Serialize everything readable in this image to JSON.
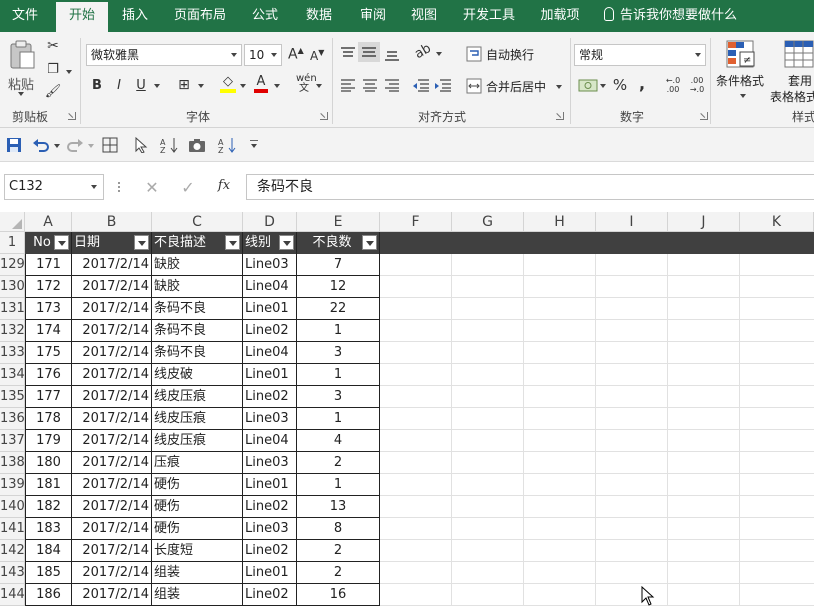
{
  "ribbon_tabs": [
    "文件",
    "开始",
    "插入",
    "页面布局",
    "公式",
    "数据",
    "审阅",
    "视图",
    "开发工具",
    "加载项"
  ],
  "tell_me": "告诉我你想要做什么",
  "clipboard": {
    "paste_label": "粘贴",
    "group_label": "剪贴板"
  },
  "font": {
    "name": "微软雅黑",
    "size": "10",
    "group_label": "字体",
    "bold": "B",
    "italic": "I",
    "underline": "U"
  },
  "alignment": {
    "wrap_text": "自动换行",
    "merge_center": "合并后居中",
    "group_label": "对齐方式"
  },
  "number": {
    "format": "常规",
    "percent": "%",
    "comma": ",",
    "group_label": "数字"
  },
  "styles": {
    "conditional_format": "条件格式",
    "table_format_1": "套用",
    "table_format_2": "表格格式",
    "group_label_partial": "样式"
  },
  "name_box": "C132",
  "formula_value": "条码不良",
  "fx_label": "fx",
  "columns": [
    "A",
    "B",
    "C",
    "D",
    "E",
    "F",
    "G",
    "H",
    "I",
    "J",
    "K"
  ],
  "table_headers": [
    "No",
    "日期",
    "不良描述",
    "线别",
    "不良数"
  ],
  "header_row_number": "1",
  "rows": [
    {
      "row": "129",
      "no": "171",
      "date": "2017/2/14",
      "desc": "缺胶",
      "line": "Line03",
      "qty": "7"
    },
    {
      "row": "130",
      "no": "172",
      "date": "2017/2/14",
      "desc": "缺胶",
      "line": "Line04",
      "qty": "12"
    },
    {
      "row": "131",
      "no": "173",
      "date": "2017/2/14",
      "desc": "条码不良",
      "line": "Line01",
      "qty": "22"
    },
    {
      "row": "132",
      "no": "174",
      "date": "2017/2/14",
      "desc": "条码不良",
      "line": "Line02",
      "qty": "1"
    },
    {
      "row": "133",
      "no": "175",
      "date": "2017/2/14",
      "desc": "条码不良",
      "line": "Line04",
      "qty": "3"
    },
    {
      "row": "134",
      "no": "176",
      "date": "2017/2/14",
      "desc": "线皮破",
      "line": "Line01",
      "qty": "1"
    },
    {
      "row": "135",
      "no": "177",
      "date": "2017/2/14",
      "desc": "线皮压痕",
      "line": "Line02",
      "qty": "3"
    },
    {
      "row": "136",
      "no": "178",
      "date": "2017/2/14",
      "desc": "线皮压痕",
      "line": "Line03",
      "qty": "1"
    },
    {
      "row": "137",
      "no": "179",
      "date": "2017/2/14",
      "desc": "线皮压痕",
      "line": "Line04",
      "qty": "4"
    },
    {
      "row": "138",
      "no": "180",
      "date": "2017/2/14",
      "desc": "压痕",
      "line": "Line03",
      "qty": "2"
    },
    {
      "row": "139",
      "no": "181",
      "date": "2017/2/14",
      "desc": "硬伤",
      "line": "Line01",
      "qty": "1"
    },
    {
      "row": "140",
      "no": "182",
      "date": "2017/2/14",
      "desc": "硬伤",
      "line": "Line02",
      "qty": "13"
    },
    {
      "row": "141",
      "no": "183",
      "date": "2017/2/14",
      "desc": "硬伤",
      "line": "Line03",
      "qty": "8"
    },
    {
      "row": "142",
      "no": "184",
      "date": "2017/2/14",
      "desc": "长度短",
      "line": "Line02",
      "qty": "2"
    },
    {
      "row": "143",
      "no": "185",
      "date": "2017/2/14",
      "desc": "组装",
      "line": "Line01",
      "qty": "2"
    },
    {
      "row": "144",
      "no": "186",
      "date": "2017/2/14",
      "desc": "组装",
      "line": "Line02",
      "qty": "16"
    }
  ],
  "colors": {
    "accent": "#217346",
    "header_fill": "#404040",
    "ribbon_bg": "#f3f3f3"
  }
}
